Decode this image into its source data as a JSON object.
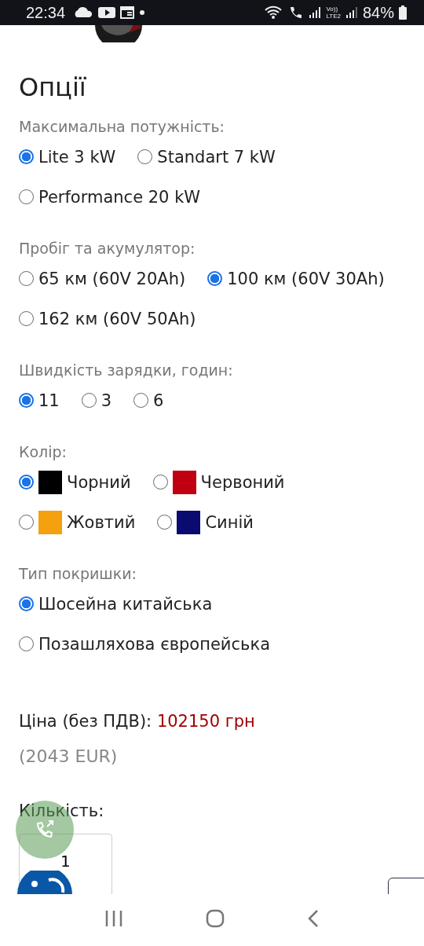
{
  "status_bar": {
    "time": "22:34",
    "network_label": [
      "Vo))",
      "LTE2"
    ],
    "battery": "84%"
  },
  "title": "Опції",
  "groups": [
    {
      "label": "Максимальна потужність:",
      "options": [
        {
          "kind": "plain",
          "label": "Lite 3 kW",
          "selected": true
        },
        {
          "kind": "plain",
          "label": "Standart 7 kW",
          "selected": false
        },
        {
          "kind": "plain",
          "label": "Performance 20 kW",
          "selected": false
        }
      ]
    },
    {
      "label": "Пробіг та акумулятор:",
      "options": [
        {
          "kind": "plain",
          "label": "65 км (60V 20Ah)",
          "selected": false
        },
        {
          "kind": "plain",
          "label": "100 км (60V 30Ah)",
          "selected": true
        },
        {
          "kind": "plain",
          "label": "162 км (60V 50Ah)",
          "selected": false
        }
      ]
    },
    {
      "label": "Швидкість зарядки, годин:",
      "options": [
        {
          "kind": "plain",
          "label": "11",
          "selected": true
        },
        {
          "kind": "plain",
          "label": "3",
          "selected": false
        },
        {
          "kind": "plain",
          "label": "6",
          "selected": false
        }
      ]
    },
    {
      "label": "Колір:",
      "options": [
        {
          "kind": "swatch",
          "label": "Чорний",
          "color": "#000000",
          "selected": true
        },
        {
          "kind": "swatch",
          "label": "Червоний",
          "color": "#c00010",
          "selected": false
        },
        {
          "kind": "swatch",
          "label": "Жовтий",
          "color": "#f5a00e",
          "selected": false
        },
        {
          "kind": "swatch",
          "label": "Синій",
          "color": "#0a0a70",
          "selected": false
        }
      ]
    },
    {
      "label": "Тип покришки:",
      "options": [
        {
          "kind": "plain",
          "label": "Шосейна китайська",
          "selected": true
        },
        {
          "kind": "plain",
          "label": "Позашляхова європейська",
          "selected": false
        }
      ]
    }
  ],
  "price": {
    "label": "Ціна (без ПДВ):",
    "value": "102150 грн",
    "eur": "(2043 EUR)"
  },
  "quantity": {
    "label": "Кількість:",
    "value": "1"
  }
}
